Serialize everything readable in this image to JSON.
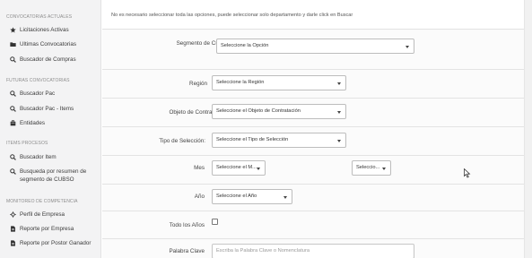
{
  "sidebar": {
    "sections": [
      {
        "title": "CONVOCATORIAS ACTUALES"
      },
      {
        "title": "FUTURAS CONVOCATORIAS"
      },
      {
        "title": "ITEMS PROCESOS"
      },
      {
        "title": "MONITOREO DE COMPETENCIA"
      }
    ],
    "items": [
      {
        "label": "Licitaciones Activas",
        "icon": "star-icon"
      },
      {
        "label": "Ultimas Convocatorias",
        "icon": "folder-icon"
      },
      {
        "label": "Buscador de Compras",
        "icon": "search-icon"
      },
      {
        "label": "Buscador Pac",
        "icon": "search-icon"
      },
      {
        "label": "Buscador Pac - Items",
        "icon": "search-icon"
      },
      {
        "label": "Entidades",
        "icon": "building-icon"
      },
      {
        "label": "Buscador Item",
        "icon": "search-icon"
      },
      {
        "label": "Busqueda por resumen de segmento de CUBSO",
        "icon": "search-icon"
      },
      {
        "label": "Perfil de Empresa",
        "icon": "crosshair-icon"
      },
      {
        "label": "Reporte por Empresa",
        "icon": "document-icon"
      },
      {
        "label": "Reporte por Postor Ganador",
        "icon": "document-icon"
      }
    ]
  },
  "notice": "No es necesario seleccionar toda las opciones, puede seleccionar solo departamento y darle click en Buscar",
  "form": {
    "segmento": {
      "label": "Segmento de Cubso",
      "value": "Seleccione la Opción"
    },
    "region": {
      "label": "Región",
      "value": "Seleccione la Región"
    },
    "objeto": {
      "label": "Objeto de Contratación:",
      "value": "Seleccione el Objeto de Contratación"
    },
    "tipo": {
      "label": "Tipo de Selección:",
      "value": "Seleccione el Tipo de Selección"
    },
    "mes": {
      "label": "Mes",
      "value1": "Seleccione el M...",
      "value2": "Seleccio..."
    },
    "anio": {
      "label": "Año",
      "value": "Seleccione el Año"
    },
    "todos": {
      "label": "Todo los Años"
    },
    "palabra": {
      "label": "Palabra Clave",
      "placeholder": "Escriba la Palabra Clave o Nomenclatura"
    }
  }
}
